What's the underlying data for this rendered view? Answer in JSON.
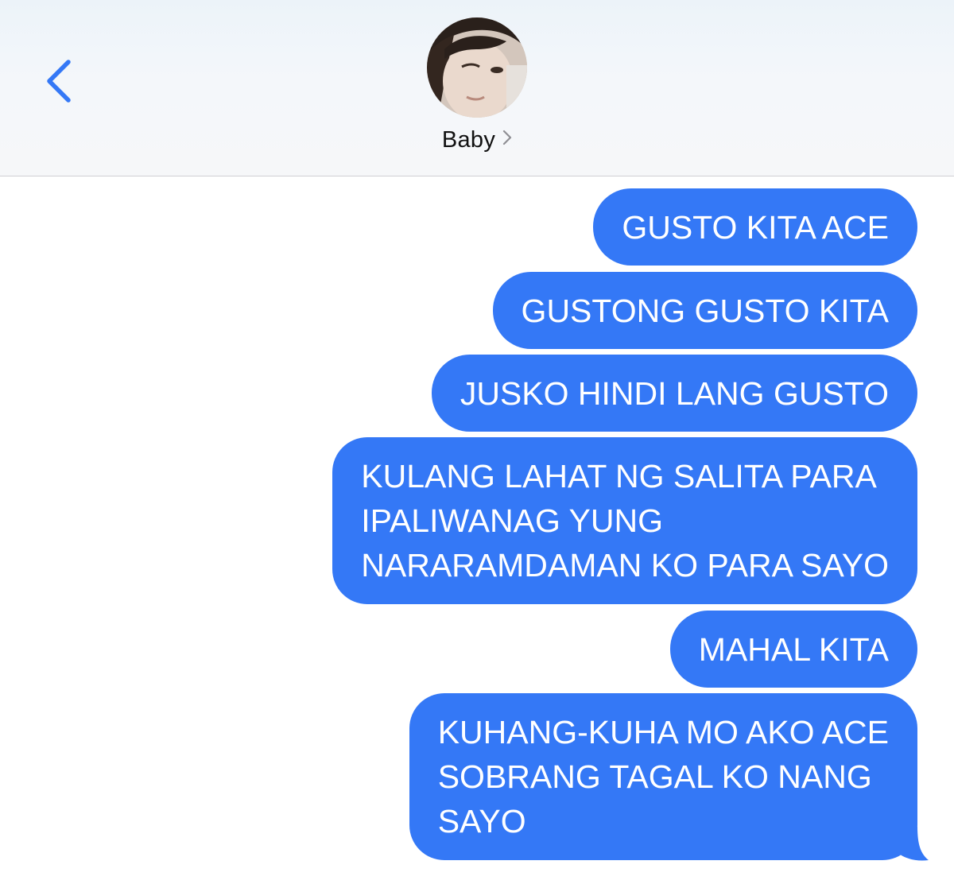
{
  "header": {
    "contact_name": "Baby",
    "back_icon": "chevron-left-icon",
    "contact_chevron_icon": "chevron-right-icon"
  },
  "colors": {
    "accent": "#3478f6",
    "bubble_text": "#ffffff",
    "header_bg": "#f4f7fa"
  },
  "messages": [
    {
      "text": "GUSTO KITA ACE"
    },
    {
      "text": "GUSTONG GUSTO KITA"
    },
    {
      "text": "JUSKO HINDI LANG GUSTO"
    },
    {
      "text": "KULANG LAHAT NG SALITA PARA\nIPALIWANAG YUNG\nNARARAMDAMAN KO PARA SAYO"
    },
    {
      "text": "MAHAL KITA"
    },
    {
      "text": "KUHANG-KUHA MO AKO ACE\nSOBRANG TAGAL KO NANG\nSAYO"
    }
  ]
}
